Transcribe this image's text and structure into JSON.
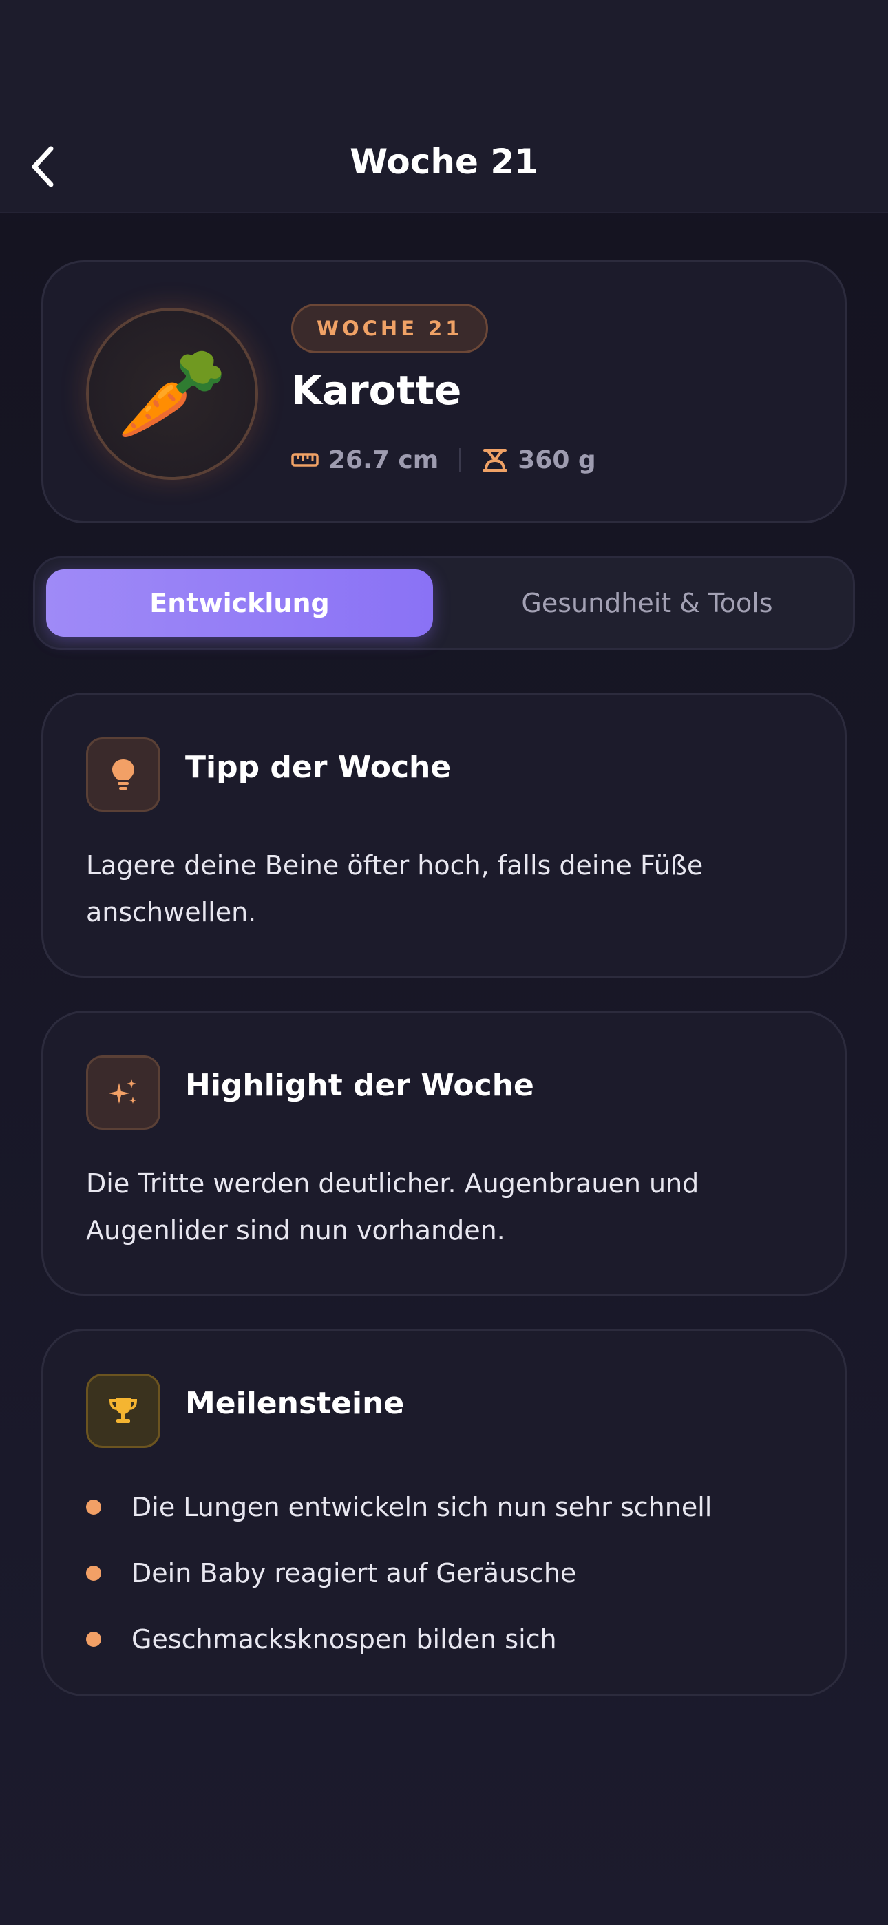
{
  "header": {
    "title": "Woche 21",
    "back_icon": "chevron-left-icon"
  },
  "hero": {
    "fruit_emoji": "🥕",
    "week_badge": "WOCHE 21",
    "fruit_name": "Karotte",
    "length": "26.7 cm",
    "weight": "360 g",
    "accent_color": "#f0a266"
  },
  "tabs": {
    "active": "Entwicklung",
    "inactive": "Gesundheit & Tools",
    "active_color": "#8f78f6"
  },
  "tip": {
    "title": "Tipp der Woche",
    "body": "Lagere deine Beine öfter hoch, falls deine Füße anschwellen.",
    "icon": "lightbulb-icon"
  },
  "highlight": {
    "title": "Highlight der Woche",
    "body": "Die Tritte werden deutlicher. Augenbrauen und Augenlider sind nun vorhanden.",
    "icon": "sparkles-icon"
  },
  "milestones": {
    "title": "Meilensteine",
    "icon": "trophy-icon",
    "items": [
      "Die Lungen entwickeln sich nun sehr schnell",
      "Dein Baby reagiert auf Geräusche",
      "Geschmacksknospen bilden sich"
    ]
  }
}
